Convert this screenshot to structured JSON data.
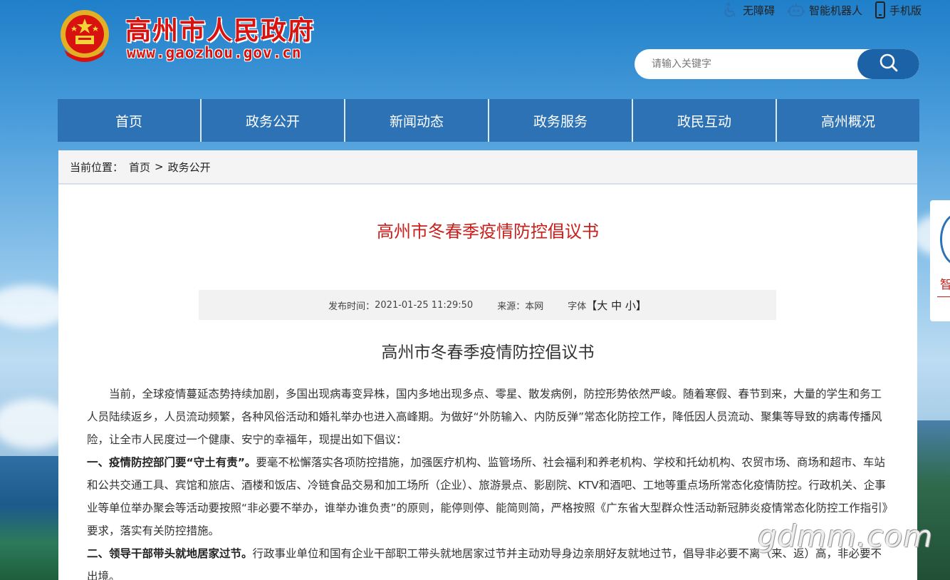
{
  "header": {
    "site_title": "高州市人民政府",
    "site_url": "www.gaozhou.gov.cn",
    "top_links": [
      {
        "label": "无障碍",
        "icon": "accessibility-icon"
      },
      {
        "label": "智能机器人",
        "icon": "robot-icon"
      },
      {
        "label": "手机版",
        "icon": "mobile-phone-icon"
      }
    ],
    "search": {
      "placeholder": "请输入关键字",
      "value": ""
    }
  },
  "nav": {
    "items": [
      "首页",
      "政务公开",
      "新闻动态",
      "政务服务",
      "政民互动",
      "高州概况"
    ]
  },
  "breadcrumb": {
    "prefix": "当前位置：",
    "items": [
      "首页",
      "政务公开"
    ],
    "separator": ">"
  },
  "article": {
    "title": "高州市冬春季疫情防控倡议书",
    "meta": {
      "publish_label": "发布时间：",
      "publish_time": "2021-01-25 11:29:50",
      "source_label": "来源：",
      "source": "本网",
      "font_label": "字体",
      "font_open": "【",
      "font_large": "大",
      "font_medium": "中",
      "font_small": "小",
      "font_close": "】"
    },
    "subtitle": "高州市冬春季疫情防控倡议书",
    "intro": "当前，全球疫情蔓延态势持续加剧，多国出现病毒变异株，国内多地出现多点、零星、散发病例，防控形势依然严峻。随着寒假、春节到来，大量的学生和务工人员陆续返乡，人员流动频繁，各种风俗活动和婚礼举办也进入高峰期。为做好“外防输入、内防反弹”常态化防控工作，降低因人员流动、聚集等导致的病毒传播风险，让全市人民度过一个健康、安宁的幸福年，现提出如下倡议：",
    "point1_head": "一、疫情防控部门要“守土有责”。",
    "point1_text": "要毫不松懈落实各项防控措施，加强医疗机构、监管场所、社会福利和养老机构、学校和托幼机构、农贸市场、商场和超市、车站和公共交通工具、宾馆和旅店、酒楼和饭店、冷链食品交易和加工场所（企业）、旅游景点、影剧院、KTV和酒吧、工地等重点场所常态化疫情防控。行政机关、企事业等单位举办聚会等活动要按照“非必要不举办，谁举办谁负责”的原则，能停则停、能简则简，严格按照《广东省大型群众性活动新冠肺炎疫情常态化防控工作指引》要求，落实有关防控措施。",
    "point2_head": "二、领导干部带头就地居家过节。",
    "point2_text": "行政事业单位和国有企业干部职工带头就地居家过节并主动劝导身边亲朋好友就地过节，倡导非必要不离（来、返）高，非必要不出境。"
  },
  "side_widget": {
    "label": "智"
  },
  "watermark": "gdmm.com",
  "colors": {
    "nav_bg": "#2c72b4",
    "title_red": "#c8201c",
    "search_btn": "#1b63a6"
  }
}
